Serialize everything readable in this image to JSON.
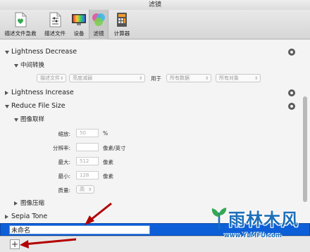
{
  "window": {
    "title": "滤镜"
  },
  "toolbar": {
    "items": [
      {
        "label": "描述文件急救",
        "icon": "document-heart-icon"
      },
      {
        "label": "描述文件",
        "icon": "document-sliders-icon"
      },
      {
        "label": "设备",
        "icon": "monitor-icon"
      },
      {
        "label": "滤镜",
        "icon": "filter-circles-icon",
        "active": true
      },
      {
        "label": "计算器",
        "icon": "calculator-icon"
      }
    ]
  },
  "filters": {
    "lightness_decrease": {
      "title": "Lightness Decrease",
      "section": "中间转换",
      "popup1": "描述文件",
      "popup2": "亮度减弱",
      "for_label": "用于",
      "popup3": "所有数据",
      "popup4": "所有对象"
    },
    "lightness_increase": {
      "title": "Lightness Increase"
    },
    "reduce_file_size": {
      "title": "Reduce File Size",
      "section_sampling": "图像取样",
      "scale": {
        "label": "缩放:",
        "value": "50",
        "unit": "%"
      },
      "resolution": {
        "label": "分辨率:",
        "value": "",
        "unit": "像素/英寸"
      },
      "max": {
        "label": "最大:",
        "value": "512",
        "unit": "像素"
      },
      "min": {
        "label": "最小:",
        "value": "128",
        "unit": "像素"
      },
      "quality": {
        "label": "质量:",
        "value": "高"
      },
      "section_compression": "图像压缩"
    },
    "sepia_tone": {
      "title": "Sepia Tone"
    },
    "new_filter_name": "未命名"
  },
  "bottom": {
    "add_label": "+"
  },
  "watermark": {
    "title": "雨林木风",
    "url": "www.YLMFU.com"
  },
  "colors": {
    "selection": "#0d5fd8",
    "arrow": "#b30000",
    "watermark": "#1d6fb8"
  }
}
